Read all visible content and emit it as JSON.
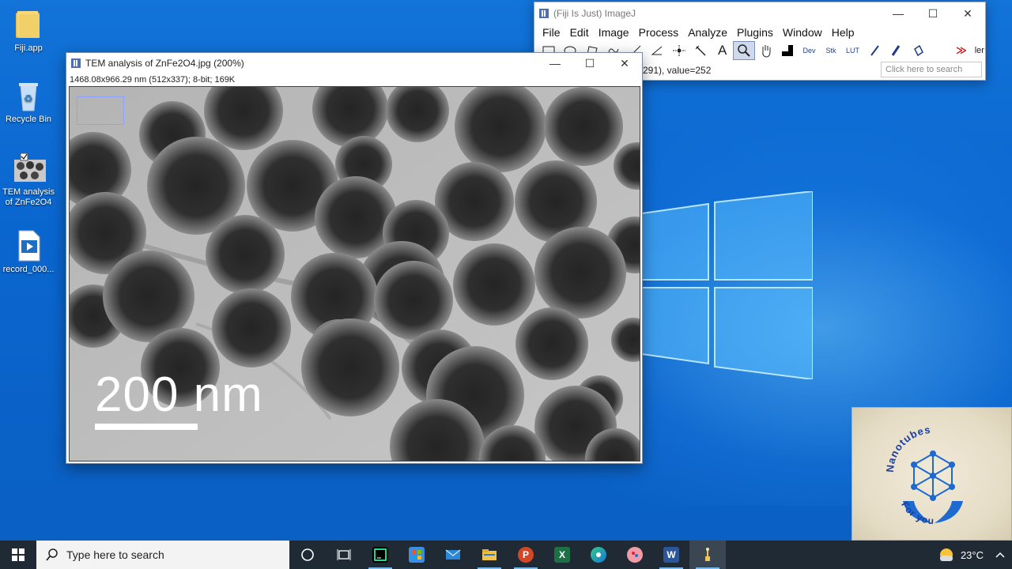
{
  "desktop": {
    "icons": [
      {
        "label": "Fiji.app"
      },
      {
        "label": "Recycle Bin"
      },
      {
        "label": "TEM analysis of ZnFe2O4"
      },
      {
        "label": "record_000..."
      }
    ]
  },
  "imagej": {
    "title": "(Fiji Is Just) ImageJ",
    "menu": [
      "File",
      "Edit",
      "Image",
      "Process",
      "Analyze",
      "Plugins",
      "Window",
      "Help"
    ],
    "tools": [
      "rectangle-tool",
      "oval-tool",
      "polygon-tool",
      "freehand-tool",
      "line-tool",
      "angle-tool",
      "point-tool",
      "wand-tool",
      "text-tool",
      "magnifier-tool",
      "hand-tool",
      "color-picker-tool",
      "dev-tool",
      "stk-tool",
      "lut-tool",
      "pencil-tool",
      "brush-tool",
      "flood-fill-tool",
      "more-tools"
    ],
    "tool_labels": {
      "text": "A",
      "dev": "Dev",
      "stk": "Stk",
      "lut": "LUT",
      "more": "≫",
      "overflow": "ler"
    },
    "status": "291), value=252",
    "search_placeholder": "Click here to search"
  },
  "image_window": {
    "title": "TEM analysis of ZnFe2O4.jpg (200%)",
    "info": "1468.08x966.29 nm (512x337); 8-bit; 169K",
    "scale_text": "200 nm"
  },
  "logo": {
    "top_text": "Nanotubes",
    "bottom_text": "For you"
  },
  "taskbar": {
    "search_placeholder": "Type here to search",
    "temperature": "23°C",
    "apps": [
      "cortana",
      "task-view",
      "pycharm",
      "store",
      "mail",
      "file-explorer",
      "powerpoint",
      "excel",
      "edge",
      "paint",
      "word",
      "fiji"
    ]
  },
  "colors": {
    "accent": "#0a66cf",
    "taskbar": "#1f2a35"
  }
}
